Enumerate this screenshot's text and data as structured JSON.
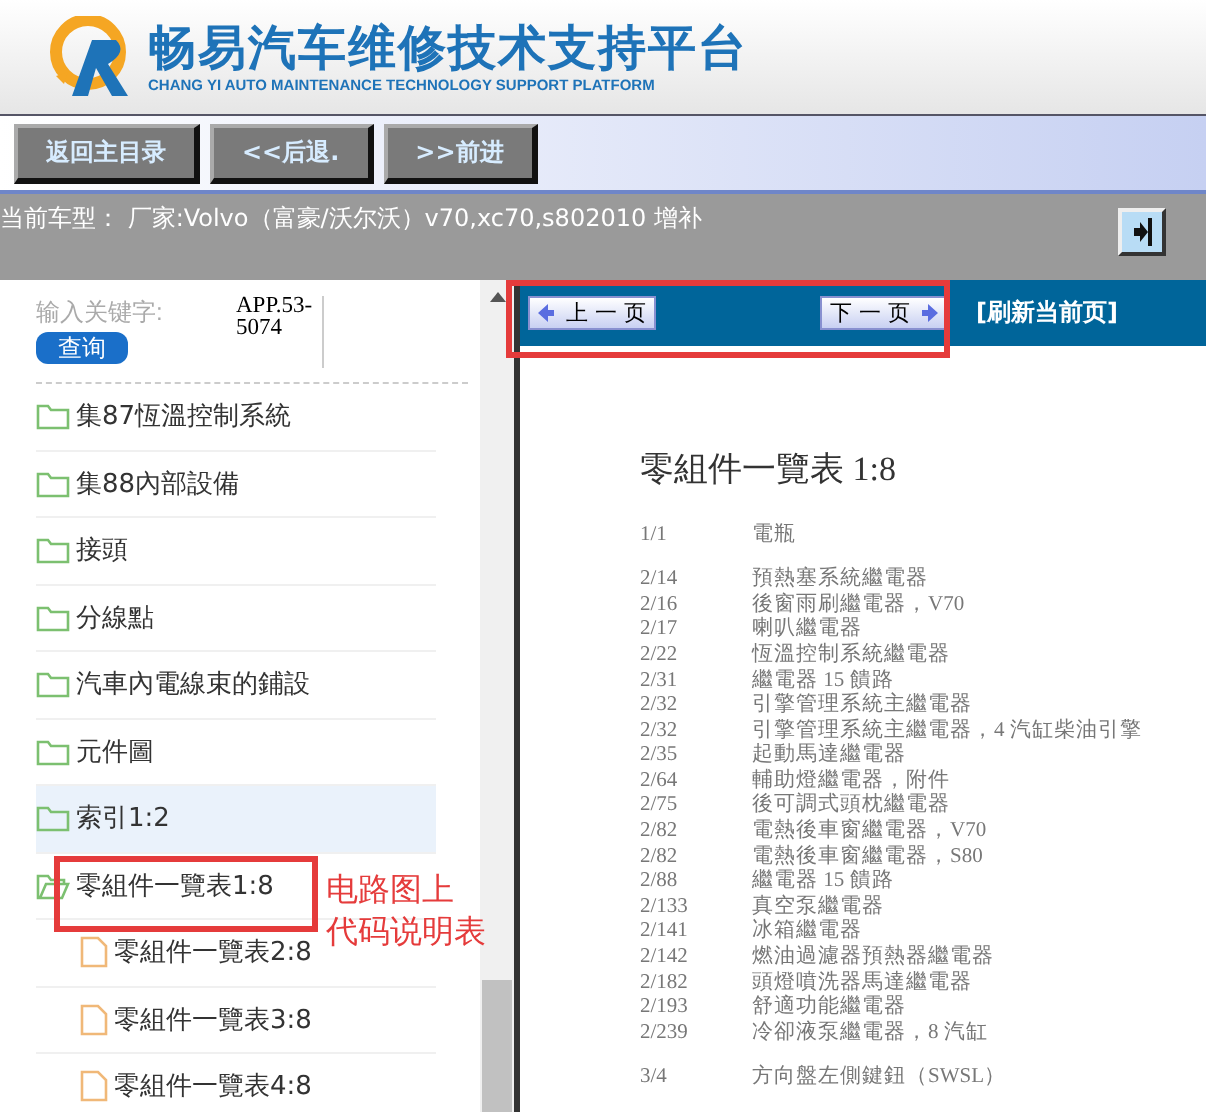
{
  "header": {
    "title": "畅易汽车维修技术支持平台",
    "subtitle": "CHANG YI AUTO MAINTENANCE TECHNOLOGY SUPPORT PLATFORM"
  },
  "toolbar": {
    "buttons": [
      "返回主目录",
      "<<后退.",
      ">>前进"
    ]
  },
  "model_bar": {
    "text": "当前车型：  厂家:Volvo（富豪/沃尔沃）v70,xc70,s802010 增补"
  },
  "search": {
    "placeholder": "输入关键字:",
    "value": "APP.53-5074",
    "button": "查询"
  },
  "tree": [
    {
      "label": "集87恆溫控制系統",
      "kind": "folder",
      "selected": false
    },
    {
      "label": "集88內部設備",
      "kind": "folder",
      "selected": false
    },
    {
      "label": "接頭",
      "kind": "folder",
      "selected": false
    },
    {
      "label": "分線點",
      "kind": "folder",
      "selected": false
    },
    {
      "label": "汽車內電線束的鋪設",
      "kind": "folder",
      "selected": false
    },
    {
      "label": "元件圖",
      "kind": "folder",
      "selected": false
    },
    {
      "label": "索引1:2",
      "kind": "folder",
      "selected": true
    },
    {
      "label": "零組件一覽表1:8",
      "kind": "folder",
      "selected": false,
      "expanded": true,
      "children": [
        {
          "label": "零組件一覽表2:8",
          "kind": "file",
          "selected": false
        },
        {
          "label": "零組件一覽表3:8",
          "kind": "file",
          "selected": false
        },
        {
          "label": "零組件一覽表4:8",
          "kind": "file",
          "selected": false
        }
      ]
    }
  ],
  "annotation": {
    "lines": [
      "电路图上",
      "代码说明表"
    ]
  },
  "nav": {
    "prev": "上 一 页",
    "next": "下 一 页",
    "refresh": "[刷新当前页]"
  },
  "document": {
    "title": "零組件一覽表 1:8",
    "groups": [
      [
        {
          "code": "1/1",
          "text": "電瓶"
        }
      ],
      [
        {
          "code": "2/14",
          "text": "預熱塞系統繼電器"
        },
        {
          "code": "2/16",
          "text": "後窗雨刷繼電器，V70"
        },
        {
          "code": "2/17",
          "text": "喇叭繼電器"
        },
        {
          "code": "2/22",
          "text": "恆溫控制系統繼電器"
        },
        {
          "code": "2/31",
          "text": "繼電器 15 饋路"
        },
        {
          "code": "2/32",
          "text": "引擎管理系統主繼電器"
        },
        {
          "code": "2/32",
          "text": "引擎管理系統主繼電器，4 汽缸柴油引擎"
        },
        {
          "code": "2/35",
          "text": "起動馬達繼電器"
        },
        {
          "code": "2/64",
          "text": "輔助燈繼電器，附件"
        },
        {
          "code": "2/75",
          "text": "後可調式頭枕繼電器"
        },
        {
          "code": "2/82",
          "text": "電熱後車窗繼電器，V70"
        },
        {
          "code": "2/82",
          "text": "電熱後車窗繼電器，S80"
        },
        {
          "code": "2/88",
          "text": "繼電器 15 饋路"
        },
        {
          "code": "2/133",
          "text": "真空泵繼電器"
        },
        {
          "code": "2/141",
          "text": "冰箱繼電器"
        },
        {
          "code": "2/142",
          "text": "燃油過濾器預熱器繼電器"
        },
        {
          "code": "2/182",
          "text": "頭燈噴洗器馬達繼電器"
        },
        {
          "code": "2/193",
          "text": "舒適功能繼電器"
        },
        {
          "code": "2/239",
          "text": "冷卻液泵繼電器，8 汽缸"
        }
      ],
      [
        {
          "code": "3/4",
          "text": "方向盤左側鍵鈕（SWSL）"
        }
      ]
    ]
  }
}
